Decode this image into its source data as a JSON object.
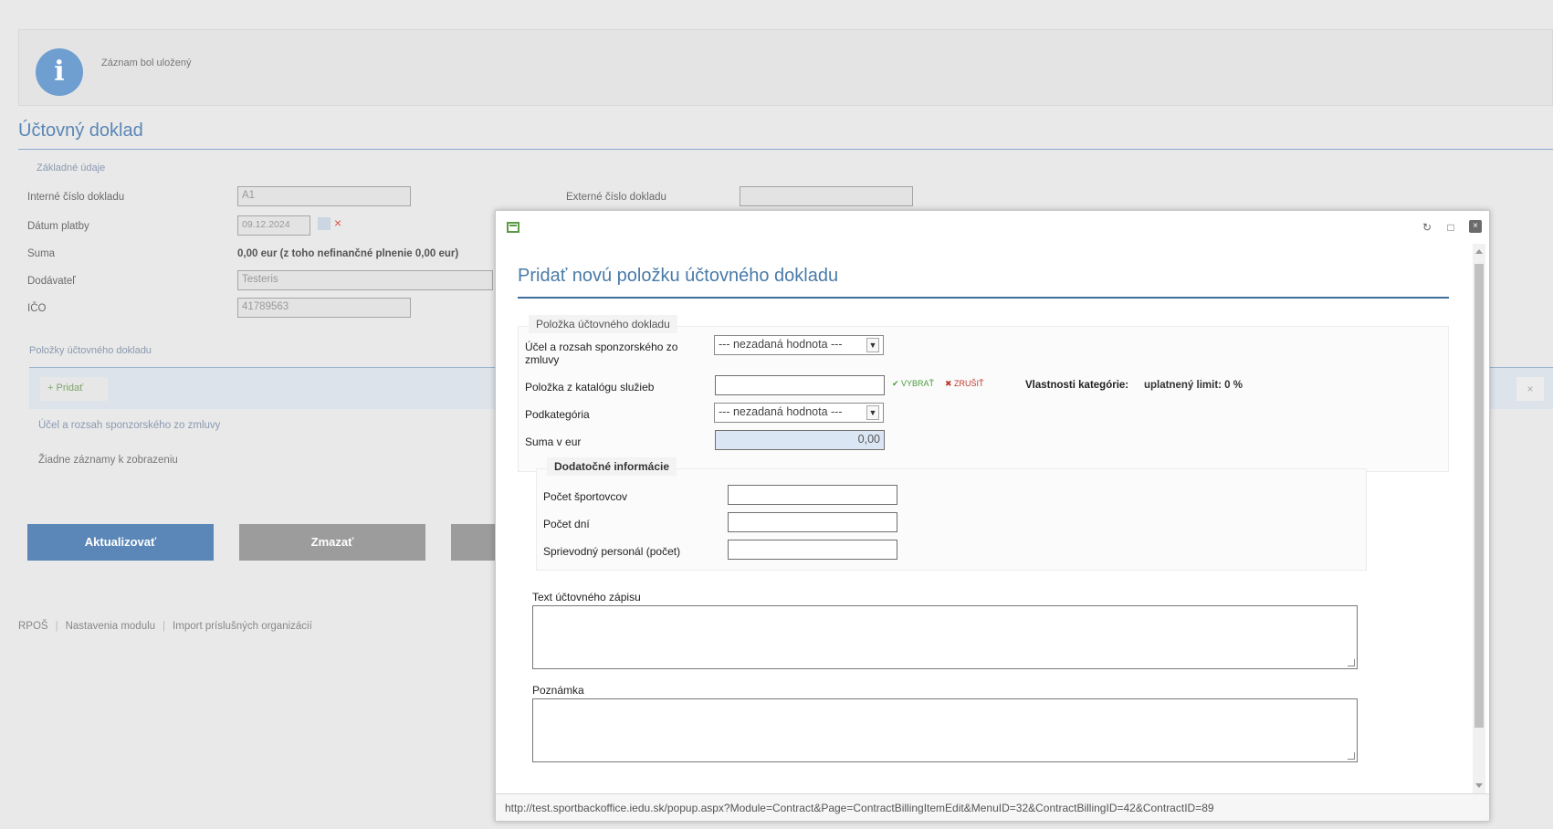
{
  "background": {
    "info_message": "Záznam bol uložený",
    "page_title": "Účtovný doklad",
    "basic_section": "Základné údaje",
    "labels": {
      "internal_number": "Interné číslo dokladu",
      "payment_date": "Dátum platby",
      "sum": "Suma",
      "supplier": "Dodávateľ",
      "ico": "IČO",
      "external_number": "Externé číslo dokladu"
    },
    "values": {
      "internal_number": "A1",
      "payment_date": "09.12.2024",
      "sum": "0,00 eur (z toho nefinančné plnenie 0,00 eur)",
      "supplier": "Testeris",
      "ico": "41789563"
    },
    "items_section": "Položky účtovného dokladu",
    "add_button": "Pridať",
    "grid_column": "Účel a rozsah sponzorského zo zmluvy",
    "grid_empty": "Žiadne záznamy k zobrazeniu",
    "buttons": {
      "update": "Aktualizovať",
      "delete": "Zmazať"
    },
    "footer": [
      "RPOŠ",
      "Nastavenia modulu",
      "Import príslušných organizácií"
    ],
    "colors": {
      "update_button": "#5b87b8",
      "delete_button": "#9c9c9c"
    }
  },
  "modal": {
    "title": "Pridať novú položku účtovného dokladu",
    "item_section": "Položka účtovného dokladu",
    "fields": {
      "purpose_label": "Účel a rozsah sponzorského zo zmluvy",
      "purpose_value": "--- nezadaná hodnota ---",
      "catalog_label": "Položka z katalógu služieb",
      "catalog_value": "",
      "choose_link": "VYBRAŤ",
      "cancel_link": "ZRUŠIŤ",
      "category_props_label": "Vlastnosti kategórie:",
      "limit_text": "uplatnený limit: 0 %",
      "subcategory_label": "Podkategória",
      "subcategory_value": "--- nezadaná hodnota ---",
      "amount_label": "Suma v eur",
      "amount_value": "0,00"
    },
    "additional_section": "Dodatočné informácie",
    "additional": {
      "athletes_label": "Počet športovcov",
      "days_label": "Počet dní",
      "staff_label": "Sprievodný personál (počet)"
    },
    "accounting_text_label": "Text účtovného zápisu",
    "note_label": "Poznámka",
    "status_url": "http://test.sportbackoffice.iedu.sk/popup.aspx?Module=Contract&Page=ContractBillingItemEdit&MenuID=32&ContractBillingID=42&ContractID=89",
    "colors": {
      "title": "#4a7aa8",
      "choose_link": "#4a9b3a",
      "cancel_link": "#c0392b"
    }
  }
}
